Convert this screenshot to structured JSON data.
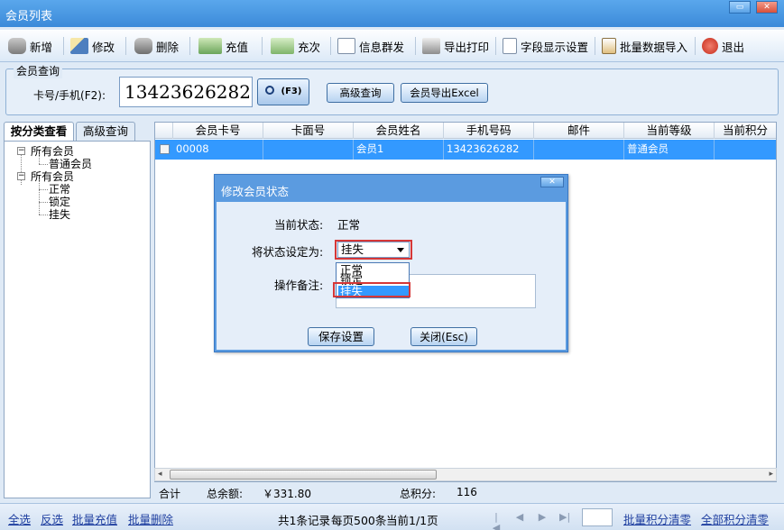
{
  "window": {
    "title": "会员列表",
    "minimize_glyph": "▭",
    "close_glyph": "✕"
  },
  "toolbar": {
    "add": "新增",
    "edit": "修改",
    "delete": "删除",
    "recharge": "充值",
    "topup_times": "充次",
    "message": "信息群发",
    "export_print": "导出打印",
    "field_display": "字段显示设置",
    "batch_import": "批量数据导入",
    "exit": "退出"
  },
  "search": {
    "legend": "会员查询",
    "label": "卡号/手机(F2):",
    "value": "13423626282",
    "search_key": "(F3)",
    "advanced_button": "高级查询",
    "export_button": "会员导出Excel"
  },
  "tree_panel": {
    "tabs": [
      "按分类查看",
      "高级查询"
    ],
    "nodes": [
      {
        "label": "所有会员",
        "level": 0
      },
      {
        "label": "普通会员",
        "level": 1
      },
      {
        "label": "所有会员",
        "level": 0
      },
      {
        "label": "正常",
        "level": 1
      },
      {
        "label": "锁定",
        "level": 1
      },
      {
        "label": "挂失",
        "level": 1
      }
    ]
  },
  "grid": {
    "columns": [
      "会员卡号",
      "卡面号",
      "会员姓名",
      "手机号码",
      "邮件",
      "当前等级",
      "当前积分"
    ],
    "rows": [
      {
        "card_no": "00008",
        "face_no": "",
        "name": "会员1",
        "phone": "13423626282",
        "email": "",
        "level": "普通会员",
        "points": ""
      }
    ]
  },
  "summary": {
    "total_label": "合计",
    "balance_label": "总余额:",
    "balance_value": "￥331.80",
    "points_label": "总积分:",
    "points_value": "116"
  },
  "statusbar": {
    "select_all": "全选",
    "invert": "反选",
    "batch_recharge": "批量充值",
    "batch_delete": "批量删除",
    "records": "共1条记录",
    "per_page": "每页500条",
    "page": "当前1/1页",
    "batch_clear_points": "批量积分清零",
    "clear_all_points": "全部积分清零"
  },
  "dialog": {
    "title": "修改会员状态",
    "close_glyph": "✕",
    "current_status_label": "当前状态:",
    "current_status_value": "正常",
    "set_status_label": "将状态设定为:",
    "selected_status": "挂失",
    "status_options": [
      "正常",
      "锁定",
      "挂失"
    ],
    "remark_label": "操作备注:",
    "save_button": "保存设置",
    "close_button": "关闭(Esc)"
  },
  "colors": {
    "title_bar": "#3b8ad9",
    "selection": "#3399ff",
    "highlight_border": "#d63737",
    "link": "#1f3fa0"
  }
}
